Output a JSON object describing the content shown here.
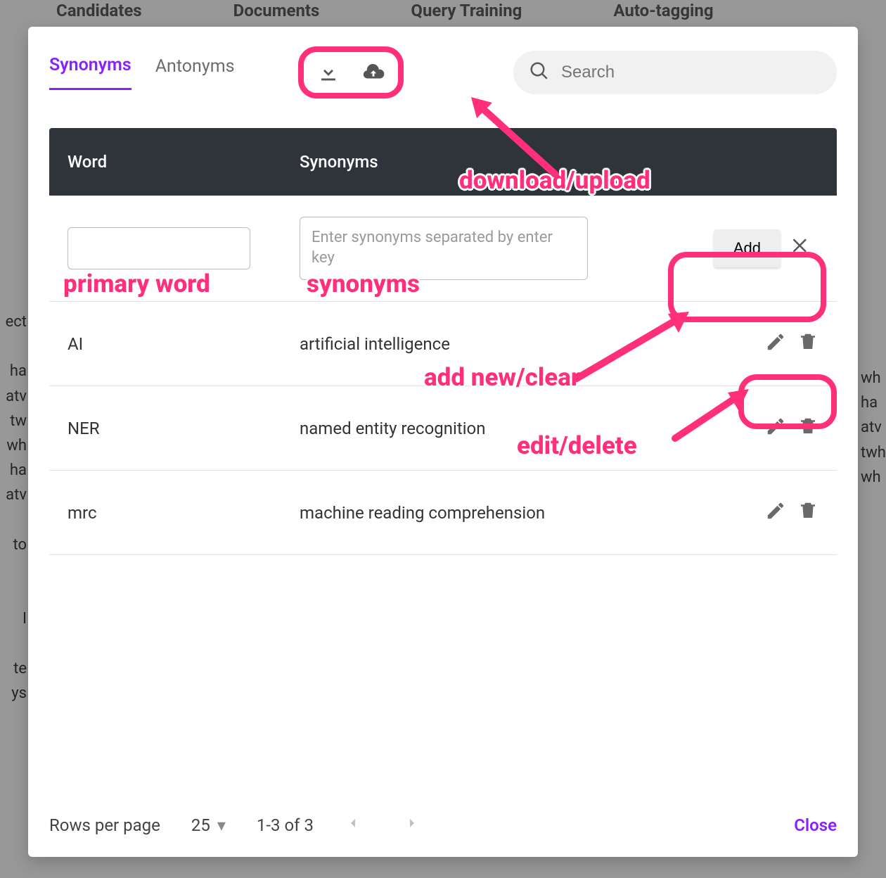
{
  "bg_nav": {
    "candidates": "Candidates",
    "documents": "Documents",
    "query_training": "Query Training",
    "auto_tagging": "Auto-tagging"
  },
  "bg_left_frag": "ect\n\nha\natv\ntw\nwh\nha\natv\n\nto\n\n\nI\n\nte\nys",
  "bg_right_frag": "wh\nha\natv\ntwh\nwh",
  "tabs": {
    "synonyms": "Synonyms",
    "antonyms": "Antonyms"
  },
  "search": {
    "placeholder": "Search"
  },
  "table": {
    "header_word": "Word",
    "header_syn": "Synonyms",
    "new_row": {
      "word_placeholder": "",
      "syn_placeholder": "Enter synonyms separated by enter key",
      "add_label": "Add"
    },
    "rows": [
      {
        "word": "AI",
        "syn": "artificial intelligence"
      },
      {
        "word": "NER",
        "syn": "named entity recognition"
      },
      {
        "word": "mrc",
        "syn": "machine reading comprehension"
      }
    ]
  },
  "footer": {
    "rows_per_page": "Rows per page",
    "page_size": "25",
    "range": "1-3 of 3",
    "close": "Close"
  },
  "annotations": {
    "download_upload": "download/upload",
    "primary_word": "primary word",
    "synonyms": "synonyms",
    "add_new_clear": "add new/clear",
    "edit_delete": "edit/delete"
  }
}
